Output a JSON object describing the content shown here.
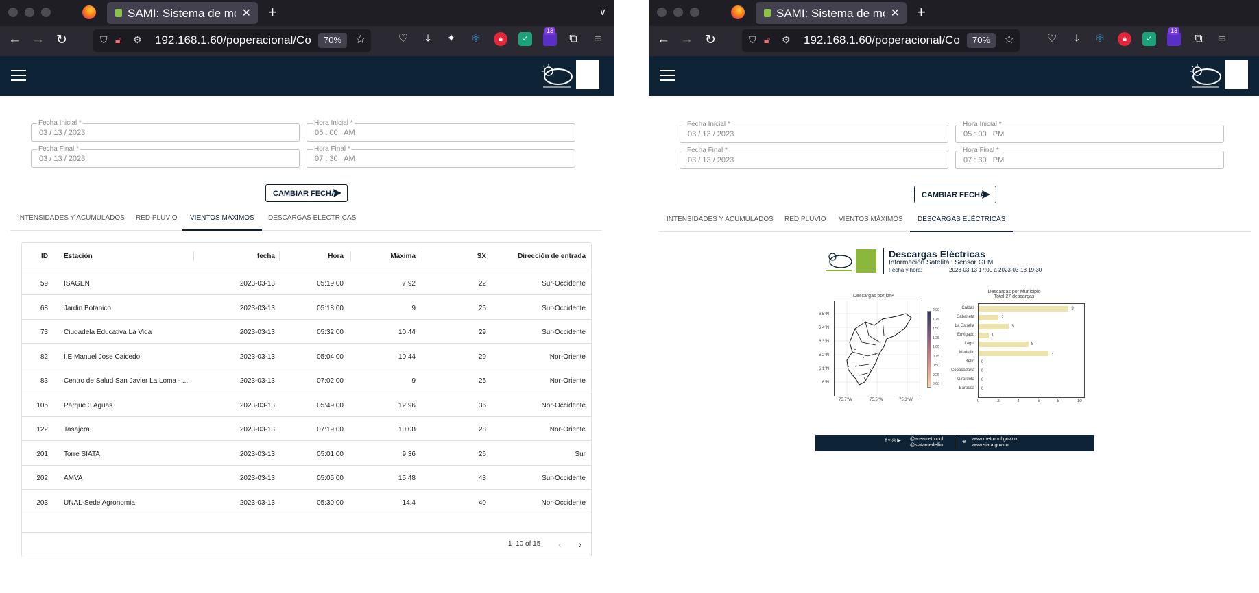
{
  "browser": {
    "tab_title": "SAMI: Sistema de moni",
    "url": "192.168.1.60/poperacional/Co",
    "zoom": "70%",
    "ext_badge": "13"
  },
  "form": {
    "fecha_inicial_label": "Fecha Inicial *",
    "hora_inicial_label": "Hora Inicial *",
    "fecha_final_label": "Fecha Final *",
    "hora_final_label": "Hora Final *",
    "submit_label": "CAMBIAR FECHA"
  },
  "tabs": [
    "INTENSIDADES Y ACUMULADOS",
    "RED PLUVIO",
    "VIENTOS MÁXIMOS",
    "DESCARGAS ELÉCTRICAS"
  ],
  "left": {
    "fecha_inicial": "03 / 13 / 2023",
    "hora_inicial": "05 : 00   AM",
    "fecha_final": "03 / 13 / 2023",
    "hora_final": "07 : 30   AM",
    "active_tab": "VIENTOS MÁXIMOS"
  },
  "right": {
    "fecha_inicial": "03 / 13 / 2023",
    "hora_inicial": "05 : 00   PM",
    "fecha_final": "03 / 13 / 2023",
    "hora_final": "07 : 30   PM",
    "active_tab": "DESCARGAS ELÉCTRICAS"
  },
  "table": {
    "headers": [
      "ID",
      "Estación",
      "fecha",
      "Hora",
      "Máxima",
      "SX",
      "Dirección de entrada"
    ],
    "rows": [
      [
        "59",
        "ISAGEN",
        "2023-03-13",
        "05:19:00",
        "7.92",
        "22",
        "Sur-Occidente"
      ],
      [
        "68",
        "Jardin Botanico",
        "2023-03-13",
        "05:18:00",
        "9",
        "25",
        "Sur-Occidente"
      ],
      [
        "73",
        "Ciudadela Educativa La Vida",
        "2023-03-13",
        "05:32:00",
        "10.44",
        "29",
        "Sur-Occidente"
      ],
      [
        "82",
        "I.E Manuel Jose Caicedo",
        "2023-03-13",
        "05:04:00",
        "10.44",
        "29",
        "Nor-Oriente"
      ],
      [
        "83",
        "Centro de Salud San Javier La Loma - ...",
        "2023-03-13",
        "07:02:00",
        "9",
        "25",
        "Nor-Oriente"
      ],
      [
        "105",
        "Parque 3 Aguas",
        "2023-03-13",
        "05:49:00",
        "12.96",
        "36",
        "Nor-Occidente"
      ],
      [
        "122",
        "Tasajera",
        "2023-03-13",
        "07:19:00",
        "10.08",
        "28",
        "Nor-Oriente"
      ],
      [
        "201",
        "Torre SIATA",
        "2023-03-13",
        "05:01:00",
        "9.36",
        "26",
        "Sur"
      ],
      [
        "202",
        "AMVA",
        "2023-03-13",
        "05:05:00",
        "15.48",
        "43",
        "Sur-Occidente"
      ],
      [
        "203",
        "UNAL-Sede Agronomia",
        "2023-03-13",
        "05:30:00",
        "14.4",
        "40",
        "Nor-Occidente"
      ]
    ],
    "pagination": "1–10 of 15"
  },
  "report": {
    "title": "Descargas Eléctricas",
    "subtitle": "Información Satelital: Sensor GLM",
    "fecha_label": "Fecha y hora:",
    "fecha_value": "2023-03-13 17:00 a 2023-03-13 19:30",
    "map_title": "Descargas por km²",
    "map_lat_ticks": [
      "6.5°N",
      "6.4°N",
      "6.3°N",
      "6.2°N",
      "6.1°N",
      "6°N"
    ],
    "map_lon_ticks": [
      "75.7°W",
      "75.5°W",
      "75.3°W"
    ],
    "colorbar_ticks": [
      "2.00",
      "1.75",
      "1.50",
      "1.25",
      "1.00",
      "0.75",
      "0.50",
      "0.25",
      "0.00"
    ],
    "bar_title_1": "Descargas por Municipio",
    "bar_title_2": "Total 27 descargas",
    "social": "@areametropol",
    "social2": "@siatamedellin",
    "web1": "www.metropol.gov.co",
    "web2": "www.siata.gov.co"
  },
  "chart_data": {
    "type": "bar",
    "orientation": "horizontal",
    "title": "Descargas por Municipio",
    "subtitle": "Total 27 descargas",
    "categories": [
      "Caldas",
      "Sabaneta",
      "La Estrella",
      "Envigado",
      "Itagui",
      "Medellin",
      "Bello",
      "Copacabana",
      "Girardota",
      "Barbosa"
    ],
    "values": [
      9,
      2,
      3,
      1,
      5,
      7,
      0,
      0,
      0,
      0
    ],
    "xlim": [
      0,
      10
    ],
    "x_ticks": [
      0,
      2,
      4,
      6,
      8,
      10
    ],
    "bar_color": "#ede3ad"
  },
  "colors": {
    "header": "#0e2336",
    "accent": "#0e2336"
  }
}
